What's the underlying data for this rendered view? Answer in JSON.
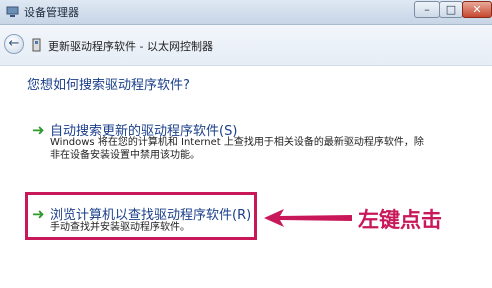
{
  "window": {
    "title": "设备管理器",
    "minimize": "–",
    "maximize": "□",
    "close": "✕"
  },
  "nav": {
    "back_glyph": "←",
    "title": "更新驱动程序软件 - 以太网控制器"
  },
  "question": "您想如何搜索驱动程序软件?",
  "options": [
    {
      "arrow": "➜",
      "title": "自动搜索更新的驱动程序软件(S)",
      "desc_line1": "Windows 将在您的计算机和 Internet 上查找用于相关设备的最新驱动程序软件，除",
      "desc_line2": "非在设备安装设置中禁用该功能。"
    },
    {
      "arrow": "➜",
      "title": "浏览计算机以查找驱动程序软件(R)",
      "desc_line1": "手动查找并安装驱动程序软件。"
    }
  ],
  "annotation": {
    "text": "左键点击",
    "color": "#c8185a"
  },
  "colors": {
    "link_blue": "#1a3f8a",
    "arrow_green": "#2e9a2e",
    "highlight": "#c8185a"
  }
}
